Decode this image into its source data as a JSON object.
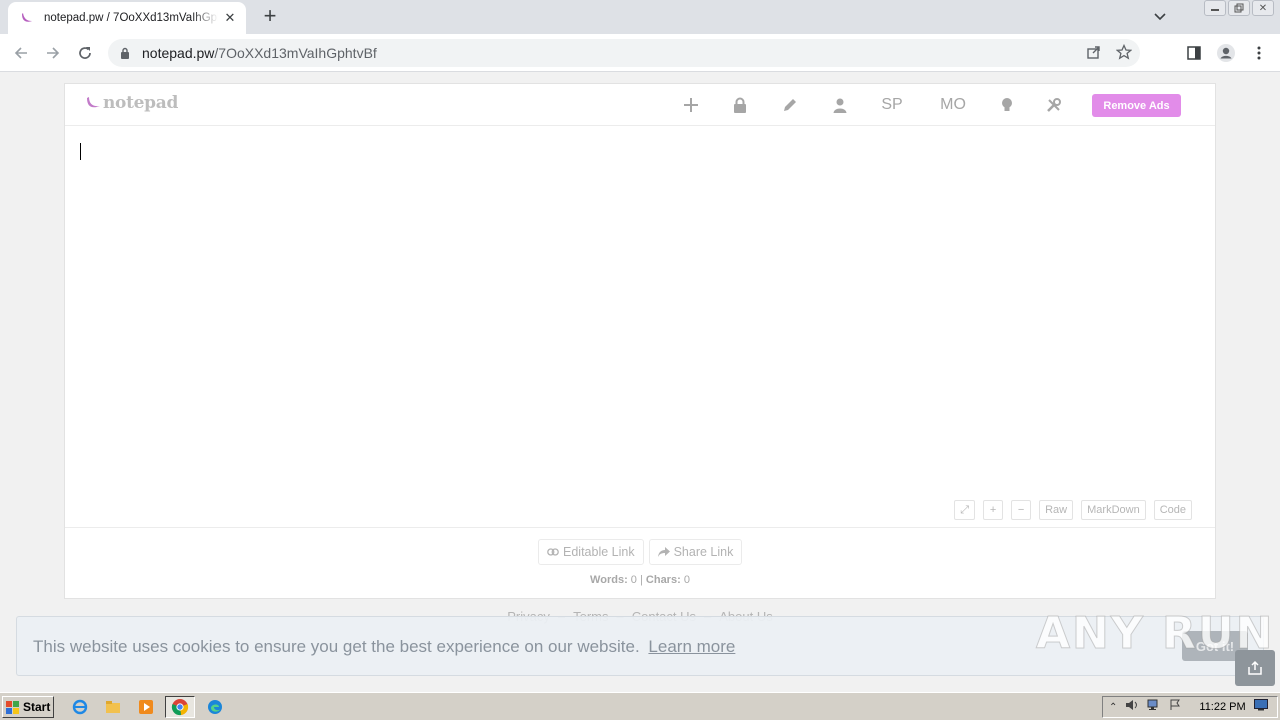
{
  "browser": {
    "tab_title": "notepad.pw / 7OoXXd13mVaIhGphtvBf",
    "url_host": "notepad.pw",
    "url_path": "/7OoXXd13mVaIhGphtvBf"
  },
  "notepad": {
    "logo": "notepad",
    "header": {
      "sp_label": "SP",
      "mo_label": "MO",
      "remove_ads": "Remove Ads"
    },
    "editor_tools": [
      "Raw",
      "MarkDown",
      "Code"
    ],
    "links": {
      "editable": "Editable Link",
      "share": "Share Link"
    },
    "stats": {
      "words_label": "Words:",
      "words": "0",
      "chars_label": "Chars:",
      "chars": "0"
    }
  },
  "page_links": [
    "Privacy",
    "Terms",
    "Contact Us",
    "About Us"
  ],
  "cookie": {
    "message": "This website uses cookies to ensure you get the best experience on our website.",
    "learn_more": "Learn more",
    "button": "Got it!"
  },
  "watermark": "ANY RUN",
  "taskbar": {
    "start": "Start",
    "clock": "11:22 PM"
  },
  "colors": {
    "accent": "#e28ce9",
    "logo_mark": "#c27bc9"
  }
}
